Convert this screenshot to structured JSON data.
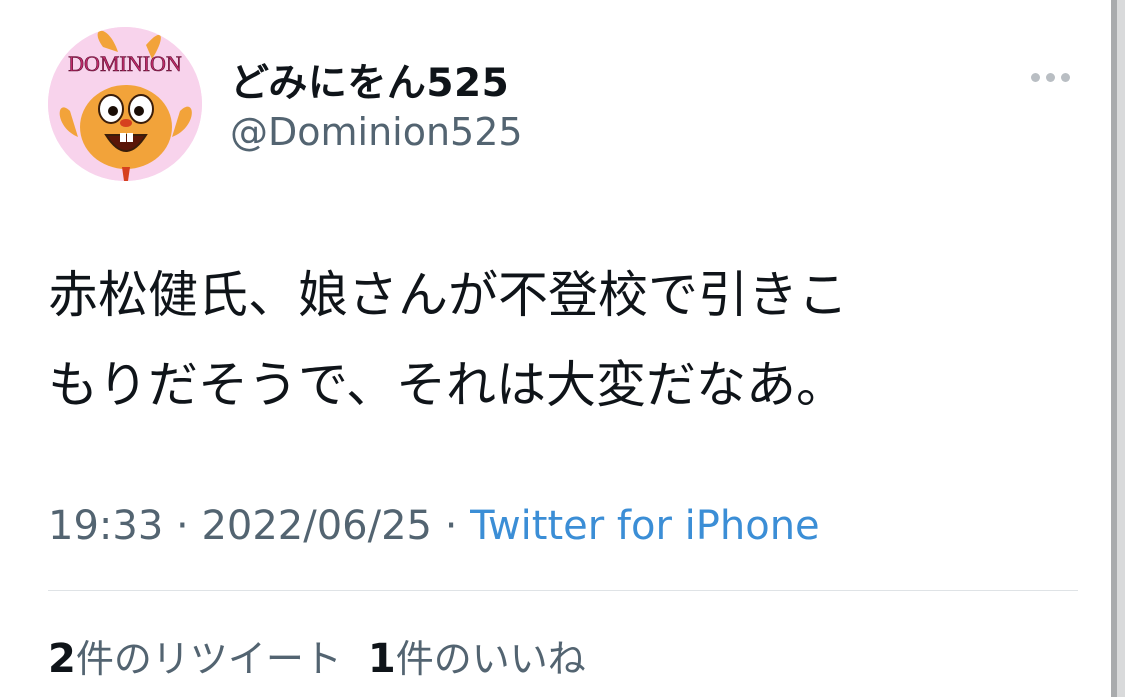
{
  "user": {
    "display_name": "どみにをん525",
    "handle": "@Dominion525",
    "avatar_text": "DOMINION"
  },
  "tweet": {
    "line1": "赤松健氏、娘さんが不登校で引きこ",
    "line2": "もりだそうで、それは大変だなあ。"
  },
  "meta": {
    "time": "19:33",
    "separator": " · ",
    "date": "2022/06/25",
    "source": "Twitter for iPhone"
  },
  "stats": {
    "retweets": {
      "count": "2",
      "label": "件のリツイート"
    },
    "likes": {
      "count": "1",
      "label": "件のいいね"
    }
  },
  "colors": {
    "handle": "#536471",
    "link": "#3b8ed6",
    "avatar_bg": "#f8d3ec"
  },
  "icons": {
    "more": "more-horizontal-icon"
  }
}
